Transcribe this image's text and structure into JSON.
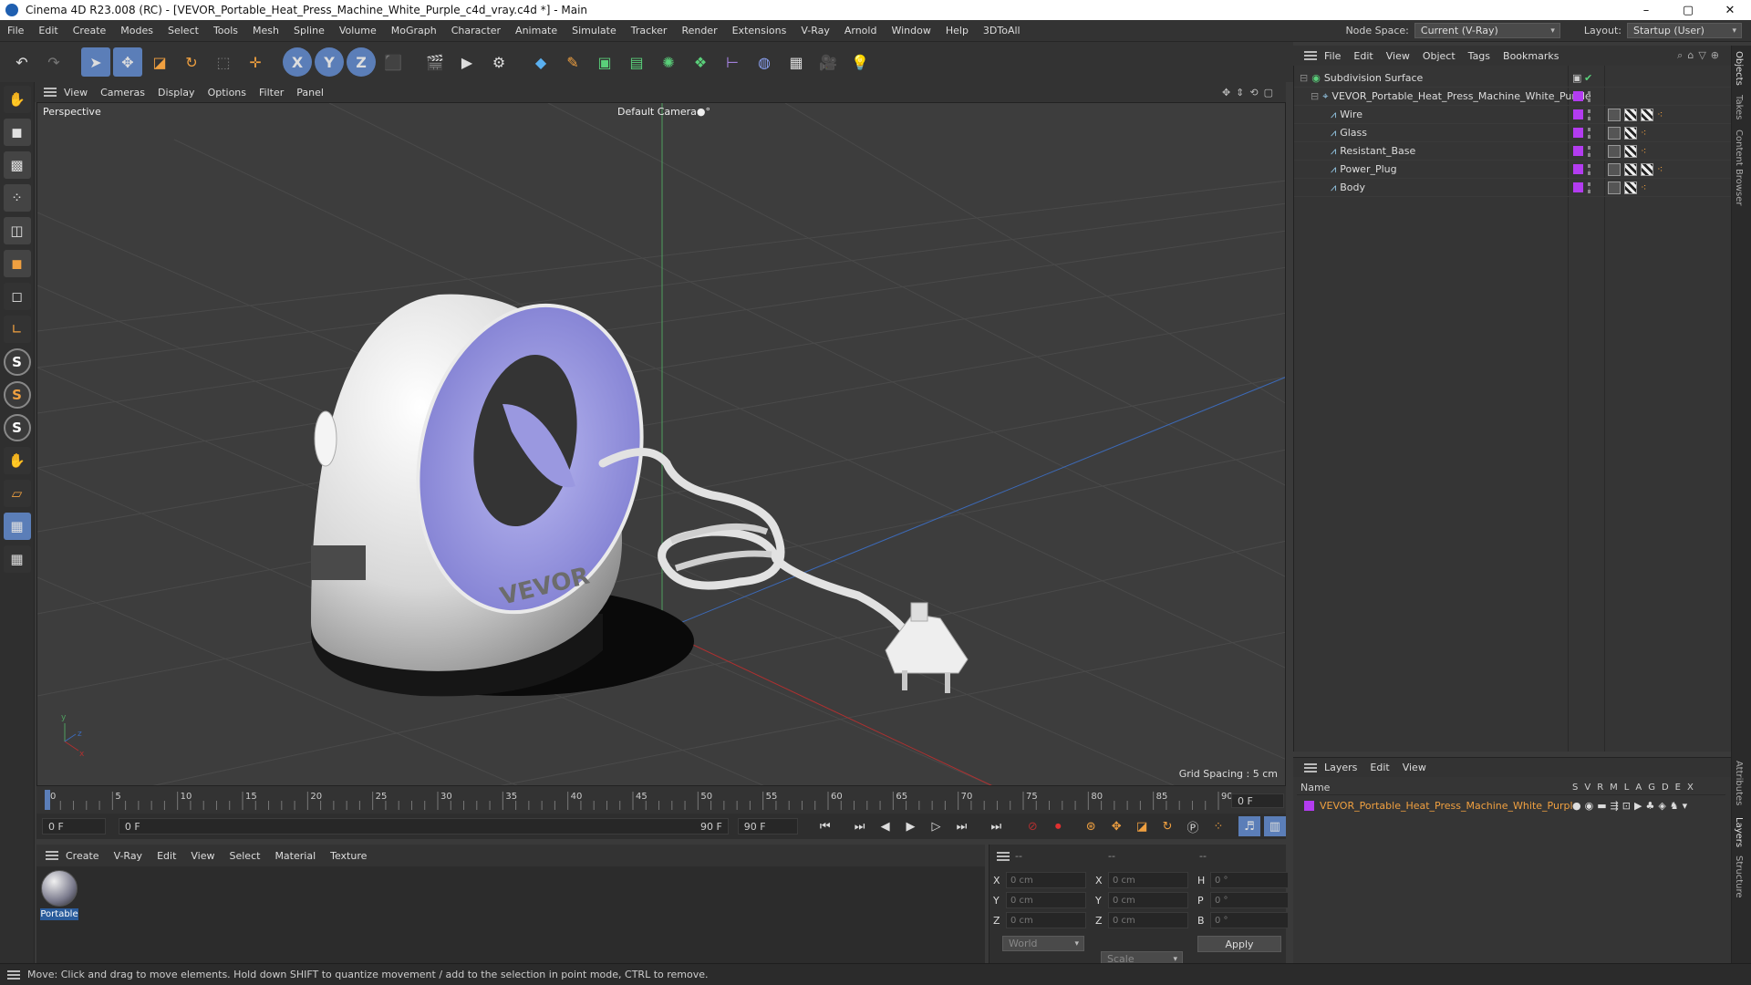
{
  "window": {
    "title": "Cinema 4D R23.008 (RC) - [VEVOR_Portable_Heat_Press_Machine_White_Purple_c4d_vray.c4d *] - Main",
    "min": "–",
    "max": "▢",
    "close": "✕"
  },
  "menu": [
    "File",
    "Edit",
    "Create",
    "Modes",
    "Select",
    "Tools",
    "Mesh",
    "Spline",
    "Volume",
    "MoGraph",
    "Character",
    "Animate",
    "Simulate",
    "Tracker",
    "Render",
    "Extensions",
    "V-Ray",
    "Arnold",
    "Window",
    "Help",
    "3DToAll"
  ],
  "nodespace": {
    "label": "Node Space:",
    "value": "Current (V-Ray)"
  },
  "layout": {
    "label": "Layout:",
    "value": "Startup (User)"
  },
  "viewport_menu": [
    "View",
    "Cameras",
    "Display",
    "Options",
    "Filter",
    "Panel"
  ],
  "viewport": {
    "label": "Perspective",
    "camera": "Default Camera",
    "camera_icon": "●°",
    "grid": "Grid Spacing : 5 cm"
  },
  "timeline": {
    "ticks": [
      "0",
      "5",
      "10",
      "15",
      "20",
      "25",
      "30",
      "35",
      "40",
      "45",
      "50",
      "55",
      "60",
      "65",
      "70",
      "75",
      "80",
      "85",
      "90"
    ],
    "end_field": "0 F"
  },
  "transport": {
    "start": "0 F",
    "current": "0 F",
    "range_end": "90 F",
    "end": "90 F"
  },
  "material_menu": [
    "Create",
    "V-Ray",
    "Edit",
    "View",
    "Select",
    "Material",
    "Texture"
  ],
  "material": {
    "name": "Portable"
  },
  "coords": {
    "col_headers": [
      "--",
      "--",
      "--"
    ],
    "rows": [
      {
        "l1": "X",
        "v1": "0 cm",
        "l2": "X",
        "v2": "0 cm",
        "l3": "H",
        "v3": "0 °"
      },
      {
        "l1": "Y",
        "v1": "0 cm",
        "l2": "Y",
        "v2": "0 cm",
        "l3": "P",
        "v3": "0 °"
      },
      {
        "l1": "Z",
        "v1": "0 cm",
        "l2": "Z",
        "v2": "0 cm",
        "l3": "B",
        "v3": "0 °"
      }
    ],
    "mode": "World",
    "scale": "Scale",
    "apply": "Apply"
  },
  "objects_menu": [
    "File",
    "Edit",
    "View",
    "Object",
    "Tags",
    "Bookmarks"
  ],
  "objects": {
    "root": "Subdivision Surface",
    "group": "VEVOR_Portable_Heat_Press_Machine_White_Purple",
    "children": [
      "Wire",
      "Glass",
      "Resistant_Base",
      "Power_Plug",
      "Body"
    ]
  },
  "layers_menu": [
    "Layers",
    "Edit",
    "View"
  ],
  "layers": {
    "name_header": "Name",
    "flags": [
      "S",
      "V",
      "R",
      "M",
      "L",
      "A",
      "G",
      "D",
      "E",
      "X"
    ],
    "row": "VEVOR_Portable_Heat_Press_Machine_White_Purple"
  },
  "side_tabs": [
    "Objects",
    "Takes",
    "Content Browser",
    "Attributes",
    "Layers",
    "Structure"
  ],
  "status": "Move: Click and drag to move elements. Hold down SHIFT to quantize movement / add to the selection in point mode, CTRL to remove.",
  "colors": {
    "accent": "#5b7eb8",
    "layer": "#b33cf0",
    "orange": "#f0a040"
  }
}
